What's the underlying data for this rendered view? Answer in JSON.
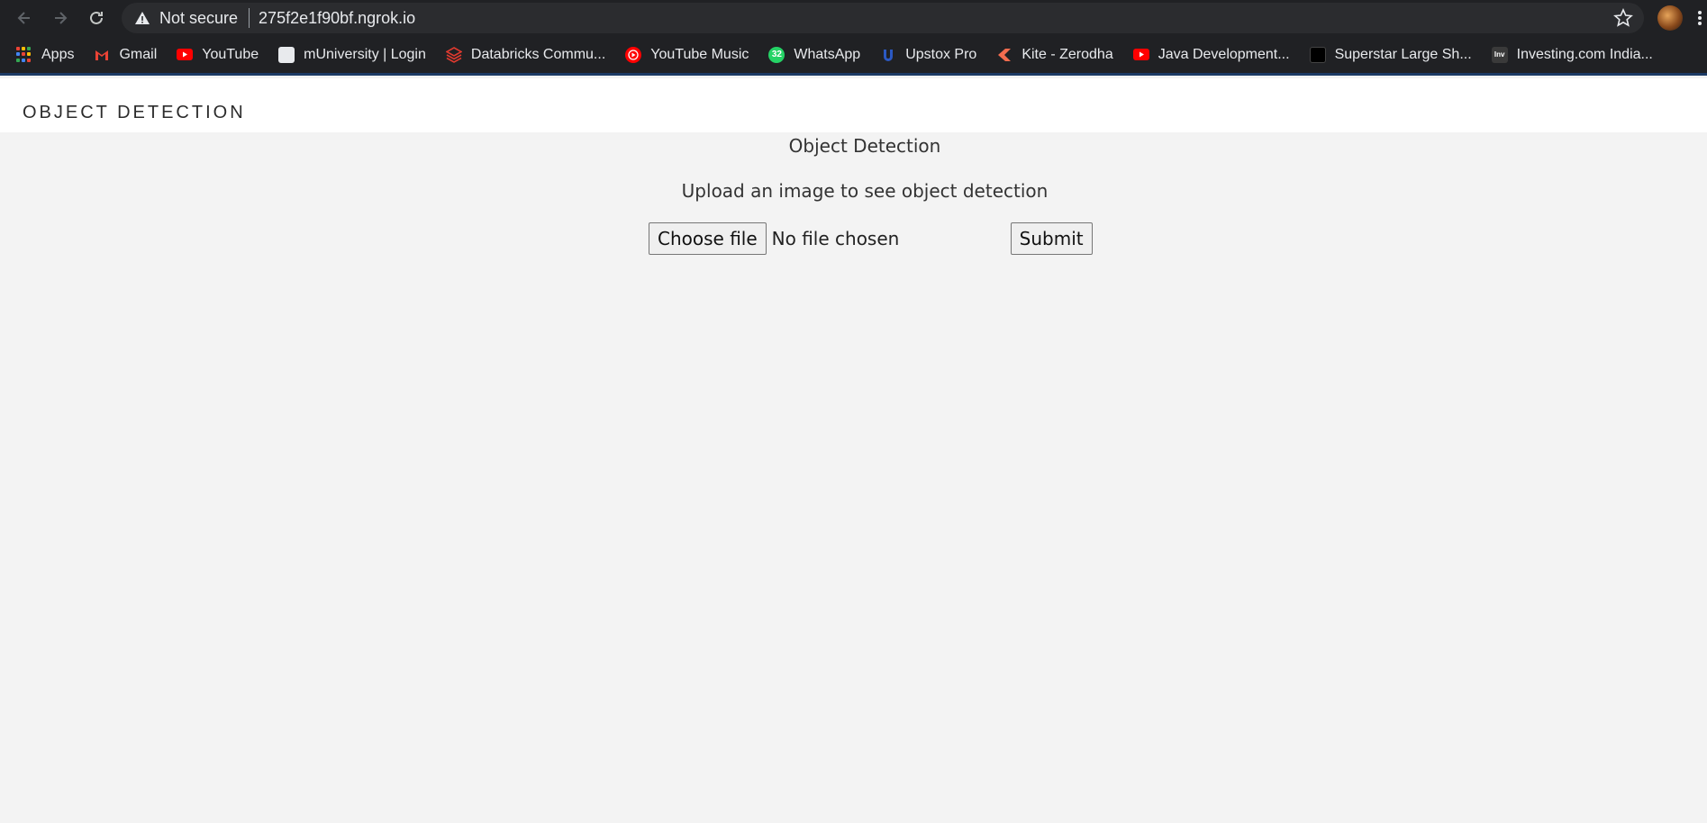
{
  "browser": {
    "security_label": "Not secure",
    "url": "275f2e1f90bf.ngrok.io",
    "bookmarks": [
      {
        "label": "Apps",
        "icon": "apps-grid-icon"
      },
      {
        "label": "Gmail",
        "icon": "gmail-icon",
        "color": "#ea4335"
      },
      {
        "label": "YouTube",
        "icon": "youtube-icon",
        "color": "#ff0000"
      },
      {
        "label": "mUniversity | Login",
        "icon": "muniversity-icon",
        "color": "#d0d0d0"
      },
      {
        "label": "Databricks Commu...",
        "icon": "databricks-icon",
        "color": "#e03a2f"
      },
      {
        "label": "YouTube Music",
        "icon": "youtube-music-icon",
        "color": "#ff0000"
      },
      {
        "label": "WhatsApp",
        "icon": "whatsapp-icon",
        "color": "#25d366"
      },
      {
        "label": "Upstox Pro",
        "icon": "upstox-icon",
        "color": "#2b59c3"
      },
      {
        "label": "Kite - Zerodha",
        "icon": "kite-icon",
        "color": "#f26c4f"
      },
      {
        "label": "Java Development...",
        "icon": "youtube-icon",
        "color": "#ff0000"
      },
      {
        "label": "Superstar Large Sh...",
        "icon": "superstar-icon",
        "color": "#000000"
      },
      {
        "label": "Investing.com India...",
        "icon": "investing-icon",
        "color": "#3a3a3a"
      }
    ]
  },
  "page": {
    "site_title": "OBJECT DETECTION",
    "heading": "Object Detection",
    "subheading": "Upload an image to see object detection",
    "choose_file_label": "Choose file",
    "file_status": "No file chosen",
    "submit_label": "Submit"
  },
  "colors": {
    "chrome_bg": "#202124",
    "omnibox_bg": "#2b2c2f",
    "page_bg": "#f3f3f3",
    "header_bg": "#ffffff"
  }
}
